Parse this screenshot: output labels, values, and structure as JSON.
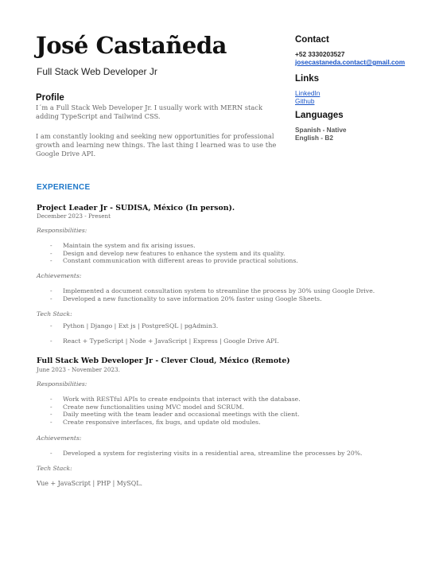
{
  "header": {
    "name": "José Castañeda",
    "title": "Full Stack Web Developer Jr"
  },
  "profile": {
    "heading": "Profile",
    "paragraphs": [
      "I´m a Full Stack Web Developer Jr. I usually work with MERN stack adding TypeScript and Tailwind CSS.",
      "I am constantly looking and seeking new opportunities for professional growth and learning new things. The last thing I learned was to use the Google Drive API."
    ]
  },
  "contact": {
    "heading": "Contact",
    "phone": "+52 3330203527",
    "email": "josecastaneda.contact@gmail.com"
  },
  "links": {
    "heading": "Links",
    "items": [
      "LinkedIn",
      "Github"
    ]
  },
  "languages": {
    "heading": "Languages",
    "items": [
      "Spanish - Native",
      "English - B2"
    ]
  },
  "experience": {
    "heading": "EXPERIENCE",
    "jobs": [
      {
        "title": "Project Leader Jr - SUDISA, México (In person).",
        "dates": "December 2023 - Present",
        "resp_label": "Responsibilities:",
        "responsibilities": [
          "Maintain the system and fix arising issues.",
          "Design and develop new features to enhance the system and its quality.",
          "Constant communication with different areas to provide practical solutions."
        ],
        "ach_label": "Achievements:",
        "achievements": [
          "Implemented a document consultation system to streamline the process by 30% using Google Drive.",
          "Developed a new functionality to save information 20% faster using Google Sheets."
        ],
        "stack_label": "Tech Stack:",
        "stack": [
          "Python | Django | Ext js | PostgreSQL | pgAdmin3.",
          "React + TypeScript | Node + JavaScript | Express | Google Drive API."
        ]
      },
      {
        "title": "Full Stack Web Developer Jr - Clever Cloud, México (Remote)",
        "dates": "June 2023 - November 2023.",
        "resp_label": "Responsibilities:",
        "responsibilities": [
          "Work with RESTful APIs to create endpoints that interact with the database.",
          "Create new functionalities using MVC model and SCRUM.",
          "Daily meeting with the team leader and occasional meetings with the client.",
          "Create responsive interfaces, fix bugs, and update old modules."
        ],
        "ach_label": "Achievements:",
        "achievements": [
          "Developed a system for registering visits in a residential area, streamline the processes by 20%."
        ],
        "stack_label": "Tech Stack:",
        "stack": [
          "Vue + JavaScript | PHP | MySQL."
        ]
      }
    ]
  }
}
